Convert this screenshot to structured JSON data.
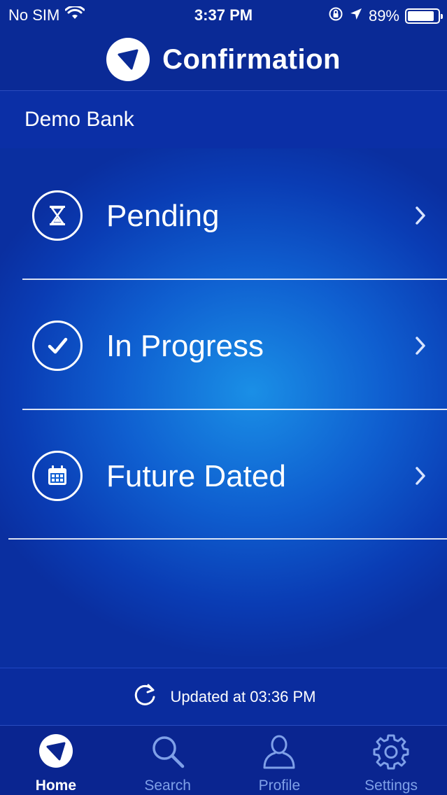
{
  "status_bar": {
    "carrier": "No SIM",
    "time": "3:37 PM",
    "battery": "89%",
    "battery_level": 0.89,
    "icons": [
      "wifi-icon",
      "orientation-lock-icon",
      "location-arrow-icon",
      "battery-icon"
    ]
  },
  "header": {
    "title": "Confirmation",
    "logo_icon": "app-logo-icon"
  },
  "bank": {
    "name": "Demo Bank"
  },
  "menu": {
    "items": [
      {
        "label": "Pending",
        "icon": "hourglass-icon"
      },
      {
        "label": "In Progress",
        "icon": "checkmark-icon"
      },
      {
        "label": "Future Dated",
        "icon": "calendar-icon"
      }
    ]
  },
  "updated": {
    "text": "Updated at 03:36 PM",
    "icon": "refresh-icon"
  },
  "tabs": [
    {
      "label": "Home",
      "icon": "home-logo-icon",
      "active": true
    },
    {
      "label": "Search",
      "icon": "search-icon",
      "active": false
    },
    {
      "label": "Profile",
      "icon": "profile-icon",
      "active": false
    },
    {
      "label": "Settings",
      "icon": "gear-icon",
      "active": false
    }
  ],
  "colors": {
    "background": "#0a3cb4",
    "header": "#0a2a96",
    "tab_inactive": "#7fa0e8",
    "text": "#ffffff"
  }
}
